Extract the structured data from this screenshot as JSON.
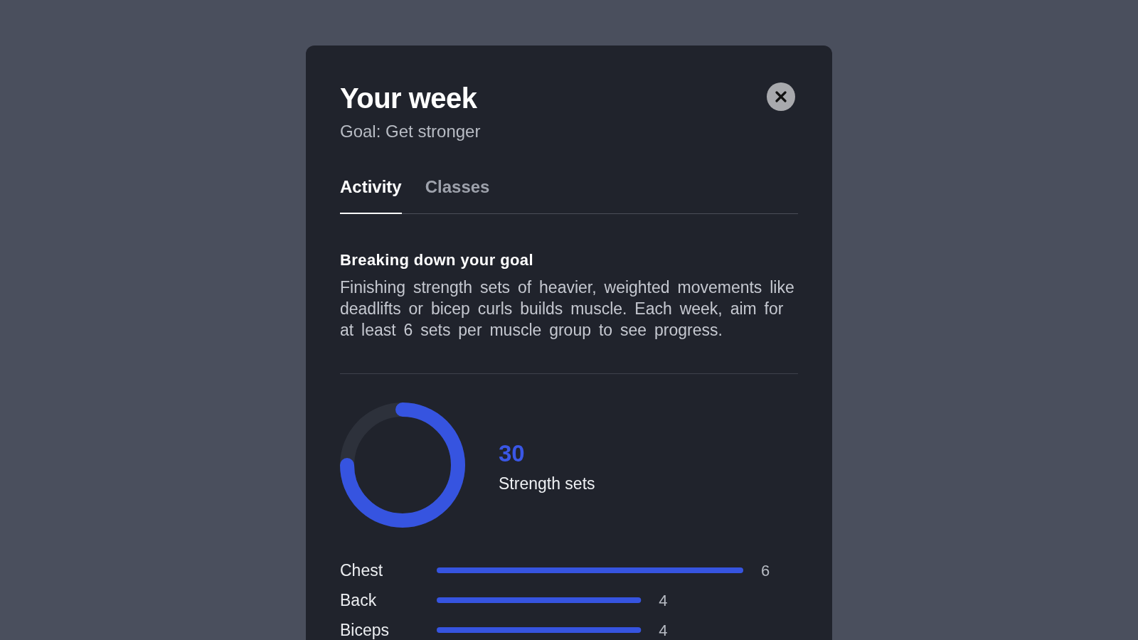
{
  "dialog": {
    "title": "Your week",
    "subtitle": "Goal: Get stronger"
  },
  "tabs": [
    {
      "label": "Activity",
      "selected": true
    },
    {
      "label": "Classes",
      "selected": false
    }
  ],
  "goal_info": {
    "heading": "Breaking down your goal",
    "body": "Finishing strength sets of heavier, weighted movements like deadlifts or bicep curls builds muscle. Each week, aim for at least 6 sets per muscle group to see progress."
  },
  "summary": {
    "level": 0.75,
    "count": "30",
    "label": "Strength sets"
  },
  "sets_by_muscle": {
    "chart_data": [
      {
        "type": "bar",
        "orientation": "horizontal",
        "categories": [
          "Chest",
          "Back",
          "Biceps"
        ],
        "values": [
          6,
          4,
          4
        ],
        "color": "#3654e0",
        "data_labels": true
      }
    ]
  }
}
